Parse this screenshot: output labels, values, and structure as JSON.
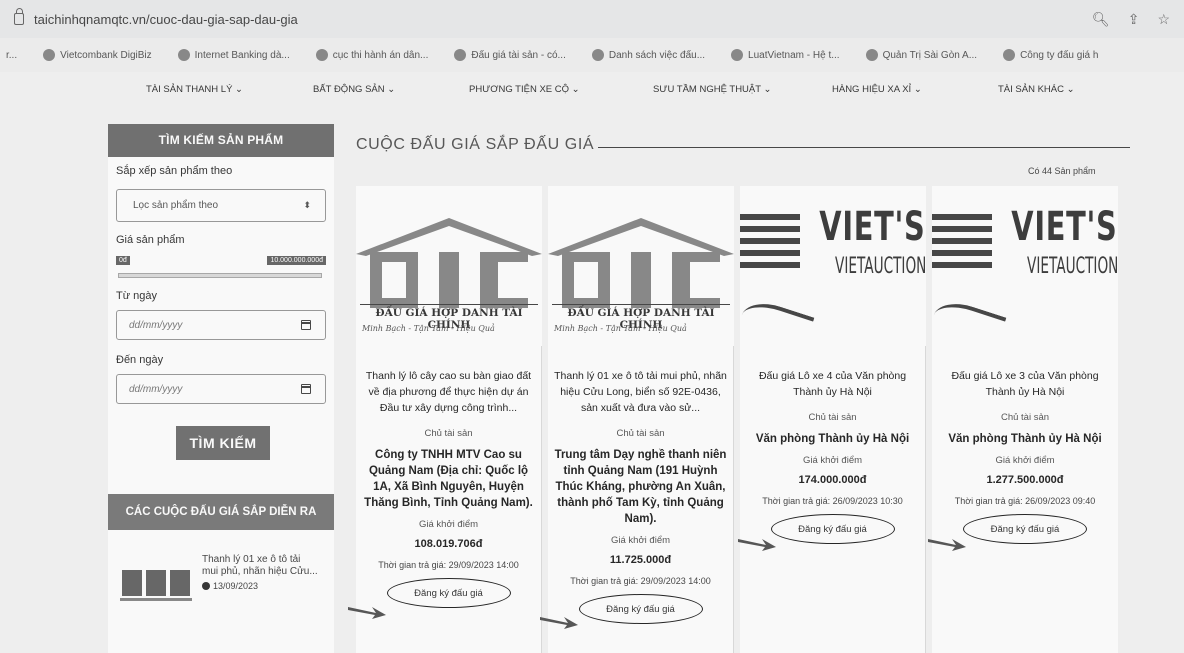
{
  "browser": {
    "url": "taichinhqnamqtc.vn/cuoc-dau-gia-sap-dau-gia",
    "bookmarks": [
      "r...",
      "Vietcombank DigiBiz",
      "Internet Banking dà...",
      "cục thi hành án dân...",
      "Đấu giá tài sản - có...",
      "Danh sách việc đấu...",
      "LuatVietnam - Hệ t...",
      "Quản Trị Sài Gòn A...",
      "Công ty đấu giá h"
    ]
  },
  "nav": {
    "items": [
      "TÀI SẢN THANH LÝ ⌄",
      "BẤT ĐỘNG SẢN ⌄",
      "PHƯƠNG TIỆN XE CỘ ⌄",
      "SƯU TẦM NGHỆ THUẬT ⌄",
      "HÀNG HIỆU XA XỈ ⌄",
      "TÀI SẢN KHÁC ⌄"
    ]
  },
  "sidebar": {
    "search_header": "TÌM KIẾM SẢN PHẨM",
    "sort_label": "Sắp xếp sản phẩm theo",
    "sort_value": "Lọc sản phẩm theo",
    "price_label": "Giá sản phẩm",
    "price_min": "0đ",
    "price_max": "10.000.000.000đ",
    "from_label": "Từ ngày",
    "from_placeholder": "dd/mm/yyyy",
    "to_label": "Đến ngày",
    "to_placeholder": "dd/mm/yyyy",
    "search_button": "TÌM KIẾM",
    "upcoming_header": "CÁC CUỘC ĐẤU GIÁ SẮP DIỄN RA",
    "upcoming_item": {
      "title": "Thanh lý 01 xe ô tô tải mui phủ, nhãn hiệu Cửu...",
      "date": "13/09/2023"
    }
  },
  "main": {
    "title": "CUỘC ĐẤU GIÁ SẮP ĐẤU GIÁ",
    "count": "Có 44 Sản phẩm",
    "logo_otc": {
      "caption": "ĐẤU GIÁ HỢP DANH TÀI CHÍNH",
      "slogan": "Minh Bạch - Tận Tâm - Hiệu Quả"
    },
    "logo_viet": {
      "big": "VIET'S",
      "small": "VIETAUCTION"
    },
    "cards": [
      {
        "title": "Thanh lý lô cây cao su bàn giao đất về địa phương để thực hiện dự án Đầu tư xây dựng công trình...",
        "owner_label": "Chủ tài sản",
        "owner": "Công ty TNHH MTV Cao su Quảng Nam (Địa chỉ: Quốc lộ 1A, Xã Bình Nguyên, Huyện Thăng Bình, Tỉnh Quảng Nam).",
        "price_label": "Giá khởi điểm",
        "price": "108.019.706đ",
        "deadline": "Thời gian trả giá: 29/09/2023 14:00",
        "button": "Đăng ký đấu giá"
      },
      {
        "title": "Thanh lý 01 xe ô tô tải mui phủ, nhãn hiệu Cửu Long, biển số 92E-0436, sản xuất và đưa vào sử...",
        "owner_label": "Chủ tài sản",
        "owner": "Trung tâm Dạy nghề thanh niên tỉnh Quảng Nam (191 Huỳnh Thúc Kháng, phường An Xuân, thành phố Tam Kỳ, tỉnh Quảng Nam).",
        "price_label": "Giá khởi điểm",
        "price": "11.725.000đ",
        "deadline": "Thời gian trả giá: 29/09/2023 14:00",
        "button": "Đăng ký đấu giá"
      },
      {
        "title": "Đấu giá Lô xe 4 của Văn phòng Thành ủy Hà Nội",
        "owner_label": "Chủ tài sản",
        "owner": "Văn phòng Thành ủy Hà Nội",
        "price_label": "Giá khởi điểm",
        "price": "174.000.000đ",
        "deadline": "Thời gian trả giá: 26/09/2023 10:30",
        "button": "Đăng ký đấu giá"
      },
      {
        "title": "Đấu giá Lô xe 3 của Văn phòng Thành ủy Hà Nội",
        "owner_label": "Chủ tài sản",
        "owner": "Văn phòng Thành ủy Hà Nội",
        "price_label": "Giá khởi điểm",
        "price": "1.277.500.000đ",
        "deadline": "Thời gian trả giá: 26/09/2023 09:40",
        "button": "Đăng ký đấu giá"
      }
    ]
  }
}
